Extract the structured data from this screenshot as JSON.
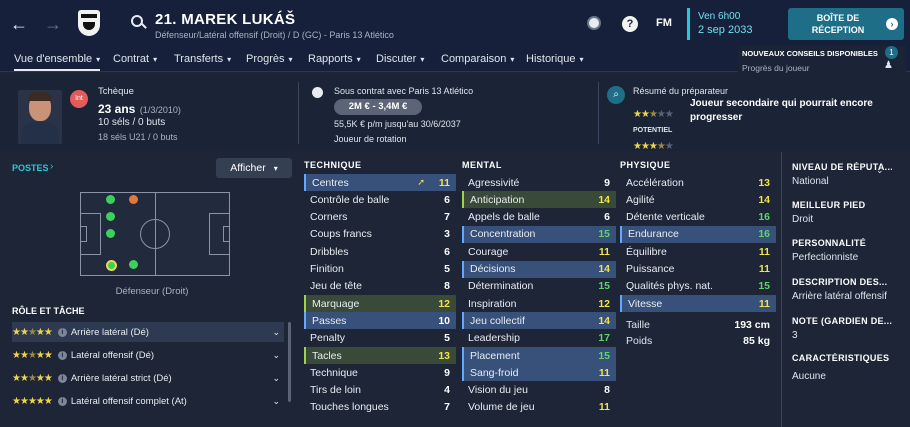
{
  "header": {
    "player_name": "21. MAREK LUKÁŠ",
    "subtitle": "Défenseur/Latéral offensif (Droit) / D (GC) - Paris 13 Atlético",
    "fm_label": "FM",
    "date_line1": "Ven 6h00",
    "date_line2": "2 sep 2033",
    "inbox_label_1": "BOÎTE DE",
    "inbox_label_2": "RÉCEPTION",
    "notif_title": "NOUVEAUX CONSEILS DISPONIBLES",
    "notif_sub": "Progrès du joueur",
    "notif_count": "1"
  },
  "nav": {
    "items": [
      "Vue d'ensemble",
      "Contrat",
      "Transferts",
      "Progrès",
      "Rapports",
      "Discuter",
      "Comparaison",
      "Historique"
    ]
  },
  "info": {
    "nationality": "Tchèque",
    "badge": "Int",
    "age": "23 ans",
    "dob": "(1/3/2010)",
    "caps": "10 séls / 0 buts",
    "u21_caps": "18 séls U21 / 0 buts",
    "contract_title": "Sous contrat avec Paris 13 Atlético",
    "value_range": "2M € - 3,4M €",
    "wage": "55,5K € p/m jusqu'au 30/6/2037",
    "role_status": "Joueur de rotation",
    "coach_title": "Résumé du préparateur",
    "coach_summary_1": "Joueur secondaire qui pourrait encore",
    "coach_summary_2": "progresser",
    "potential_label": "POTENTIEL"
  },
  "positions": {
    "title": "POSTES",
    "button": "Afficher",
    "caption": "Défenseur (Droit)"
  },
  "roles": {
    "title": "RÔLE ET TÂCHE",
    "items": [
      {
        "name": "Arrière latéral (Dé)",
        "stars": 2.5
      },
      {
        "name": "Latéral offensif (Dé)",
        "stars": 2.5
      },
      {
        "name": "Arrière latéral strict (Dé)",
        "stars": 2.5
      },
      {
        "name": "Latéral offensif complet (At)",
        "stars": 2
      }
    ]
  },
  "technique": {
    "title": "TECHNIQUE",
    "rows": [
      {
        "label": "Centres",
        "value": "11",
        "hl": "blue"
      },
      {
        "label": "Contrôle de balle",
        "value": "6",
        "hl": ""
      },
      {
        "label": "Corners",
        "value": "7",
        "hl": ""
      },
      {
        "label": "Coups francs",
        "value": "3",
        "hl": ""
      },
      {
        "label": "Dribbles",
        "value": "6",
        "hl": ""
      },
      {
        "label": "Finition",
        "value": "5",
        "hl": ""
      },
      {
        "label": "Jeu de tête",
        "value": "8",
        "hl": ""
      },
      {
        "label": "Marquage",
        "value": "12",
        "hl": "green"
      },
      {
        "label": "Passes",
        "value": "10",
        "hl": "blue"
      },
      {
        "label": "Penalty",
        "value": "5",
        "hl": ""
      },
      {
        "label": "Tacles",
        "value": "13",
        "hl": "green"
      },
      {
        "label": "Technique",
        "value": "9",
        "hl": ""
      },
      {
        "label": "Tirs de loin",
        "value": "4",
        "hl": ""
      },
      {
        "label": "Touches longues",
        "value": "7",
        "hl": ""
      }
    ]
  },
  "mental": {
    "title": "MENTAL",
    "rows": [
      {
        "label": "Agressivité",
        "value": "9",
        "hl": ""
      },
      {
        "label": "Anticipation",
        "value": "14",
        "hl": "green"
      },
      {
        "label": "Appels de balle",
        "value": "6",
        "hl": ""
      },
      {
        "label": "Concentration",
        "value": "15",
        "hl": "blue"
      },
      {
        "label": "Courage",
        "value": "11",
        "hl": ""
      },
      {
        "label": "Décisions",
        "value": "14",
        "hl": "blue"
      },
      {
        "label": "Détermination",
        "value": "15",
        "hl": ""
      },
      {
        "label": "Inspiration",
        "value": "12",
        "hl": ""
      },
      {
        "label": "Jeu collectif",
        "value": "14",
        "hl": "blue"
      },
      {
        "label": "Leadership",
        "value": "17",
        "hl": ""
      },
      {
        "label": "Placement",
        "value": "15",
        "hl": "blue"
      },
      {
        "label": "Sang-froid",
        "value": "11",
        "hl": "blue"
      },
      {
        "label": "Vision du jeu",
        "value": "8",
        "hl": ""
      },
      {
        "label": "Volume de jeu",
        "value": "11",
        "hl": ""
      }
    ]
  },
  "physique": {
    "title": "PHYSIQUE",
    "rows": [
      {
        "label": "Accélération",
        "value": "13",
        "hl": ""
      },
      {
        "label": "Agilité",
        "value": "14",
        "hl": ""
      },
      {
        "label": "Détente verticale",
        "value": "16",
        "hl": ""
      },
      {
        "label": "Endurance",
        "value": "16",
        "hl": "blue"
      },
      {
        "label": "Équilibre",
        "value": "11",
        "hl": ""
      },
      {
        "label": "Puissance",
        "value": "11",
        "hl": ""
      },
      {
        "label": "Qualités phys. nat.",
        "value": "15",
        "hl": ""
      },
      {
        "label": "Vitesse",
        "value": "11",
        "hl": "blue"
      }
    ],
    "height_label": "Taille",
    "height": "193 cm",
    "weight_label": "Poids",
    "weight": "85 kg"
  },
  "sidebar": {
    "items": [
      {
        "title": "NIVEAU DE RÉPUTA...",
        "value": "National"
      },
      {
        "title": "MEILLEUR PIED",
        "value": "Droit"
      },
      {
        "title": "PERSONNALITÉ",
        "value": "Perfectionniste"
      },
      {
        "title": "DESCRIPTION DES...",
        "value": "Arrière latéral offensif"
      },
      {
        "title": "NOTE (GARDIEN DE...",
        "value": "3"
      },
      {
        "title": "CARACTÉRISTIQUES J...",
        "value": "Aucune"
      }
    ]
  },
  "colors": {
    "accent": "#1e6e88",
    "highlight_blue": "#37517a",
    "highlight_green": "#3a4a39",
    "value_yellow": "#f0e44a",
    "value_green": "#5fd46a"
  }
}
